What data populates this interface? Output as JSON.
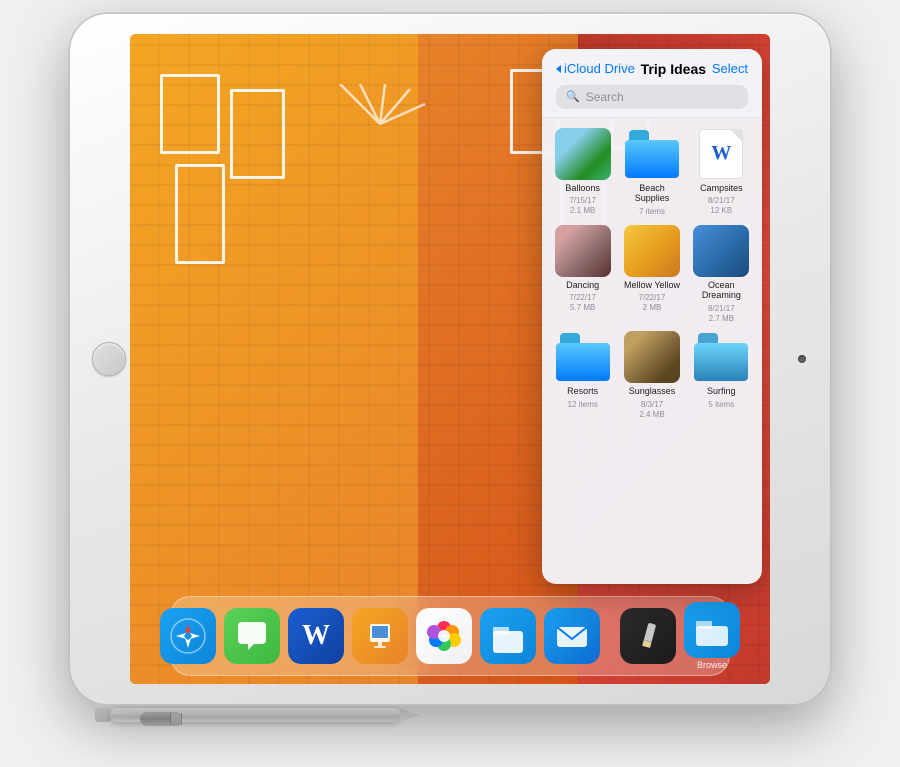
{
  "scene": {
    "background_color": "#f0f0f0"
  },
  "ipad": {
    "title": "iPad with Apple Pencil"
  },
  "panel": {
    "back_label": "iCloud Drive",
    "title": "Trip Ideas",
    "select_label": "Select",
    "search_placeholder": "Search",
    "files": [
      {
        "id": "balloons",
        "name": "Balloons",
        "date": "7/15/17",
        "size": "2.1 MB",
        "type": "image"
      },
      {
        "id": "beach-supplies",
        "name": "Beach Supplies",
        "date": "",
        "size": "7 items",
        "type": "folder-blue"
      },
      {
        "id": "campsites",
        "name": "Campsites",
        "date": "8/21/17",
        "size": "12 KB",
        "type": "word"
      },
      {
        "id": "dancing",
        "name": "Dancing",
        "date": "7/22/17",
        "size": "5.7 MB",
        "type": "image"
      },
      {
        "id": "mellow-yellow",
        "name": "Mellow Yellow",
        "date": "7/22/17",
        "size": "2 MB",
        "type": "image"
      },
      {
        "id": "ocean-dreaming",
        "name": "Ocean Dreaming",
        "date": "8/21/17",
        "size": "2.7 MB",
        "type": "image"
      },
      {
        "id": "resorts",
        "name": "Resorts",
        "date": "",
        "size": "12 items",
        "type": "folder-blue"
      },
      {
        "id": "sunglasses",
        "name": "Sunglasses",
        "date": "8/3/17",
        "size": "2.4 MB",
        "type": "image"
      },
      {
        "id": "surfing",
        "name": "Surfing",
        "date": "",
        "size": "5 items",
        "type": "folder-teal"
      }
    ]
  },
  "dock": {
    "icons": [
      {
        "id": "safari",
        "label": "Safari",
        "emoji": ""
      },
      {
        "id": "messages",
        "label": "Messages",
        "emoji": "💬"
      },
      {
        "id": "word",
        "label": "Word",
        "emoji": ""
      },
      {
        "id": "keynote",
        "label": "Keynote",
        "emoji": ""
      },
      {
        "id": "photos",
        "label": "Photos",
        "emoji": ""
      },
      {
        "id": "files",
        "label": "Files",
        "emoji": ""
      },
      {
        "id": "mail",
        "label": "Mail",
        "emoji": "✉️"
      },
      {
        "id": "pencil-app",
        "label": "",
        "emoji": "✏️"
      },
      {
        "id": "browse",
        "label": "Browse",
        "emoji": ""
      }
    ]
  }
}
